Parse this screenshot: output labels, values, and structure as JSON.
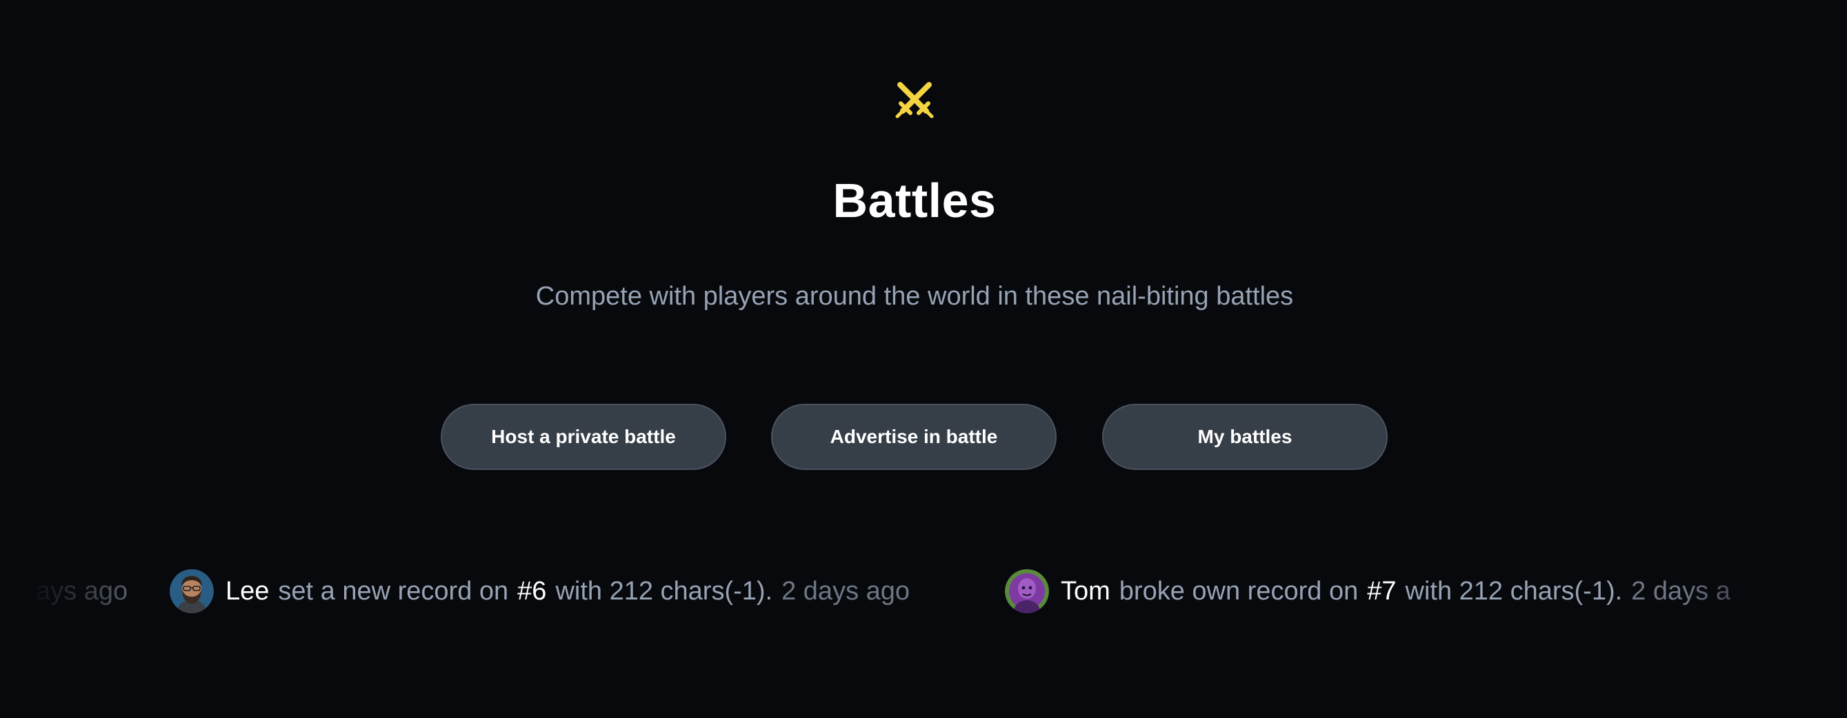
{
  "hero": {
    "icon": "crossed-swords-icon",
    "icon_color": "#f5d442",
    "title": "Battles",
    "subtitle": "Compete with players around the world in these nail-biting battles"
  },
  "actions": {
    "host_label": "Host a private battle",
    "advertise_label": "Advertise in battle",
    "my_battles_label": "My battles"
  },
  "ticker": {
    "leading_fragment": "ays ago",
    "entries": [
      {
        "user": "Lee",
        "action": "set a new record on",
        "challenge": "#6",
        "with_text": "with 212 chars(-1).",
        "time": "2 days ago",
        "avatar": "bearded-man-avatar"
      },
      {
        "user": "Tom",
        "action": "broke own record on",
        "challenge": "#7",
        "with_text": "with 212 chars(-1).",
        "time": "2 days a",
        "avatar": "purple-portrait-avatar"
      }
    ]
  },
  "colors": {
    "background": "#07090d",
    "button_bg": "#363e48",
    "subtitle_text": "#97a2b3",
    "accent_yellow": "#f5d442"
  }
}
